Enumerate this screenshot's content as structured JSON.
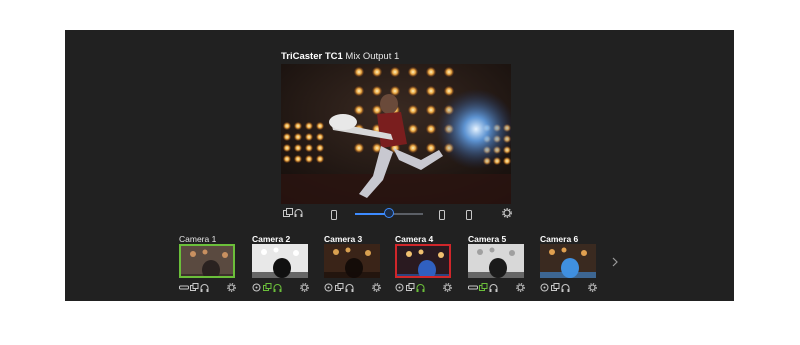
{
  "main_output": {
    "device": "TriCaster TC1",
    "output": "Mix Output 1"
  },
  "controls": {
    "level_fraction": 0.5,
    "icons": [
      "multiview-icon",
      "headphones-icon",
      "phone-portrait-icon",
      "slider",
      "phone-portrait-icon",
      "phone-portrait-icon",
      "gear-icon"
    ]
  },
  "cameras": [
    {
      "label": "Camera 1",
      "state": "preview",
      "icons": [
        "tally-bar-icon",
        "copy-icon",
        "headphones-icon",
        "gear-icon"
      ]
    },
    {
      "label": "Camera 2",
      "state": "normal",
      "icons": [
        "target-icon",
        "copy-icon-green",
        "headphones-icon-green",
        "gear-icon"
      ]
    },
    {
      "label": "Camera 3",
      "state": "normal",
      "icons": [
        "target-icon",
        "copy-icon",
        "headphones-icon",
        "gear-icon"
      ]
    },
    {
      "label": "Camera 4",
      "state": "program",
      "icons": [
        "target-icon",
        "copy-icon",
        "headphones-icon-green",
        "gear-icon"
      ]
    },
    {
      "label": "Camera 5",
      "state": "normal",
      "icons": [
        "tally-bar-icon",
        "copy-icon-green",
        "headphones-icon",
        "gear-icon"
      ]
    },
    {
      "label": "Camera 6",
      "state": "normal",
      "icons": [
        "target-icon",
        "copy-icon",
        "headphones-icon",
        "gear-icon"
      ]
    }
  ],
  "colors": {
    "panel": "#212121",
    "preview_border": "#6bbf3a",
    "program_border": "#d0262a",
    "accent_blue": "#3d8bff",
    "icon": "#c8c8c8",
    "icon_active": "#6bbf3a"
  }
}
